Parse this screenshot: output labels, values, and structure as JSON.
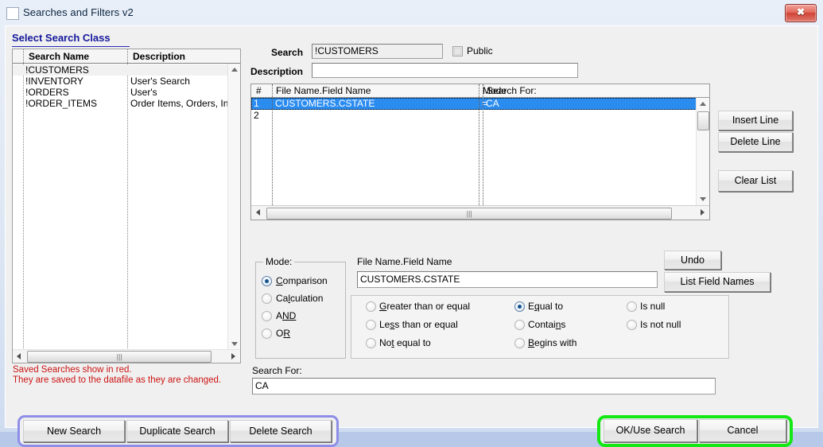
{
  "window": {
    "title": "Searches and Filters v2",
    "close_label": "✖",
    "icon": "window-icon"
  },
  "section": {
    "select_class_label": "Select Search Class"
  },
  "class_list": {
    "columns": [
      "Search Name",
      "Description"
    ],
    "rows": [
      {
        "name": "!CUSTOMERS",
        "description": ""
      },
      {
        "name": "!INVENTORY",
        "description": "User's Search"
      },
      {
        "name": "!ORDERS",
        "description": "User's"
      },
      {
        "name": "!ORDER_ITEMS",
        "description": "Order Items, Orders, Inv..."
      }
    ],
    "selected_index": 0
  },
  "notes": {
    "line1": "Saved Searches show in red.",
    "line2": "They are saved to the datafile as they are changed.",
    "color": "#cc1212"
  },
  "search_header": {
    "search_label": "Search",
    "search_value": "!CUSTOMERS",
    "description_label": "Description",
    "description_value": "",
    "description_placeholder": "",
    "public_label": "Public",
    "public_checked": false
  },
  "grid": {
    "columns": [
      "#",
      "File Name.Field Name",
      "Mode",
      "Search For:"
    ],
    "rows": [
      {
        "num": "1",
        "file_field": "CUSTOMERS.CSTATE",
        "mode": "=",
        "search_for": "CA",
        "selected": true
      },
      {
        "num": "2",
        "file_field": "",
        "mode": "",
        "search_for": "",
        "selected": false
      }
    ],
    "selection_color": "#2b8cf0"
  },
  "grid_buttons": {
    "insert_line": "Insert Line",
    "delete_line": "Delete Line",
    "clear_list": "Clear List"
  },
  "mode": {
    "legend": "Mode:",
    "options": [
      {
        "label": "Comparison",
        "accel": "C",
        "checked": true
      },
      {
        "label": "Calculation",
        "accel": "l",
        "checked": false
      },
      {
        "label": "AND",
        "accel": "N",
        "checked": false
      },
      {
        "label": "OR",
        "accel": "R",
        "checked": false
      }
    ]
  },
  "field_name": {
    "label": "File Name.Field Name",
    "value": "CUSTOMERS.CSTATE",
    "undo_label": "Undo",
    "list_fields_label": "List Field Names"
  },
  "operators": {
    "column1": [
      {
        "label": "Greater than or equal",
        "checked": false
      },
      {
        "label": "Less than or equal",
        "checked": false
      },
      {
        "label": "Not equal to",
        "checked": false
      }
    ],
    "column2": [
      {
        "label": "Equal to",
        "checked": true
      },
      {
        "label": "Contains",
        "checked": false
      },
      {
        "label": "Begins with",
        "checked": false
      }
    ],
    "column3": [
      {
        "label": "Is null",
        "checked": false
      },
      {
        "label": "Is not null",
        "checked": false
      }
    ]
  },
  "search_for": {
    "label": "Search For:",
    "value": "CA"
  },
  "bottom_buttons": {
    "new_search": "New Search",
    "duplicate_search": "Duplicate Search",
    "delete_search": "Delete Search",
    "ok_use_search": "OK/Use Search",
    "cancel": "Cancel",
    "left_group_border_color": "#8e8ee8",
    "right_group_border_color": "#14e814"
  }
}
